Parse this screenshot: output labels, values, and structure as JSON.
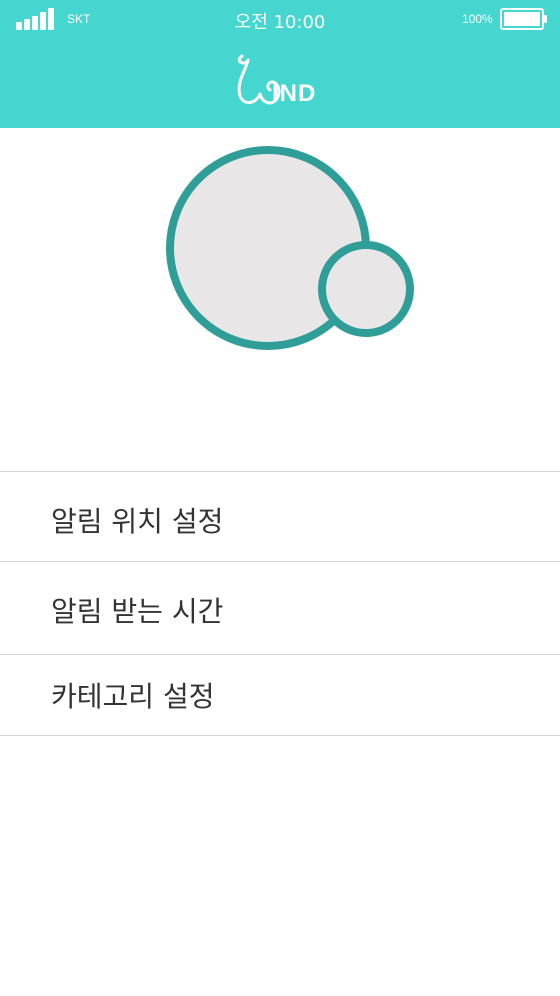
{
  "status_bar": {
    "carrier": "SKT",
    "time": "오전 10:00",
    "battery_percent": "100%",
    "signal_icon": "signal-bars-icon",
    "battery_icon": "battery-icon",
    "battery_level": 1.0
  },
  "header": {
    "logo_text": "IND",
    "logo_icon": "wind-swirl-icon",
    "background_color": "#45d6d0"
  },
  "profile": {
    "avatar_icon": "profile-circle-icon",
    "badge_icon": "small-circle-icon",
    "ring_color": "#2f9e98",
    "fill_color": "#e8e6e7"
  },
  "menu": {
    "items": [
      {
        "label": "알림 위치 설정"
      },
      {
        "label": "알림 받는 시간"
      },
      {
        "label": "카테고리 설정"
      }
    ]
  }
}
